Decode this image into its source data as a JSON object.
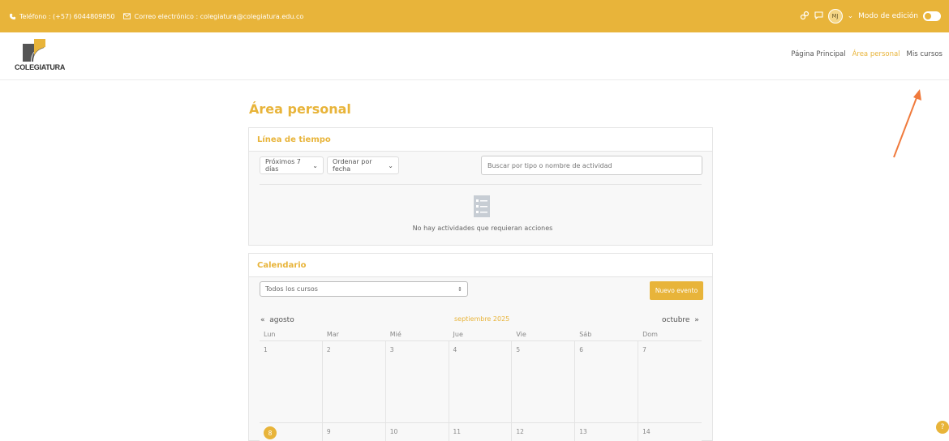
{
  "topbar": {
    "phone_text": "Teléfono : (+57) 6044809850",
    "email_text": "Correo electrónico : colegiatura@colegiatura.edu.co",
    "avatar_initials": "MJ",
    "edit_mode_label": "Modo de edición",
    "bg_color": "#e8b43a"
  },
  "logo": {
    "text": "COLEGIATURA"
  },
  "nav": {
    "home": "Página Principal",
    "personal_area": "Área personal",
    "my_courses": "Mis cursos"
  },
  "page": {
    "title": "Área personal"
  },
  "timeline": {
    "header": "Línea de tiempo",
    "filter_days": "Próximos 7 días",
    "filter_sort": "Ordenar por fecha",
    "search_placeholder": "Buscar por tipo o nombre de actividad",
    "empty_message": "No hay actividades que requieran acciones"
  },
  "calendar": {
    "header": "Calendario",
    "course_select": "Todos los cursos",
    "new_event": "Nuevo evento",
    "prev_month": "agosto",
    "current_month": "septiembre 2025",
    "next_month": "octubre",
    "weekdays": [
      "Lun",
      "Mar",
      "Mié",
      "Jue",
      "Vie",
      "Sáb",
      "Dom"
    ],
    "week1": [
      "1",
      "2",
      "3",
      "4",
      "5",
      "6",
      "7"
    ],
    "week2": [
      "8",
      "9",
      "10",
      "11",
      "12",
      "13",
      "14"
    ],
    "today": "8"
  },
  "help": {
    "label": "?"
  }
}
